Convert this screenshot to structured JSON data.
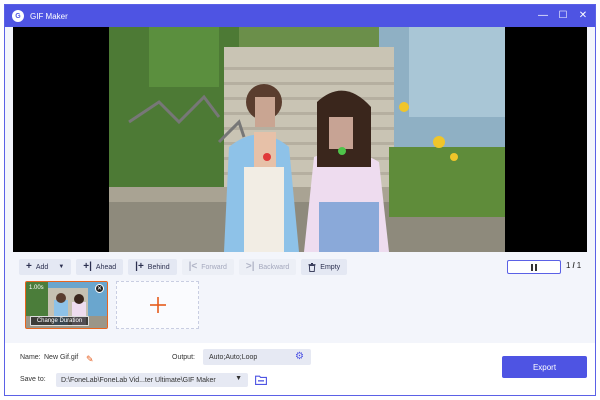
{
  "window": {
    "title": "GIF Maker",
    "minimize_glyph": "—",
    "maximize_glyph": "☐",
    "close_glyph": "✕"
  },
  "toolbar": {
    "add_label": "Add",
    "ahead_label": "Ahead",
    "behind_label": "Behind",
    "forward_label": "Forward",
    "backward_label": "Backward",
    "empty_label": "Empty"
  },
  "playback": {
    "current_page": "1",
    "total_pages": "1",
    "separator": "/"
  },
  "clips": [
    {
      "duration": "1.00s",
      "change_duration_label": "Change Duration"
    }
  ],
  "settings": {
    "name_label": "Name:",
    "name_value": "New Gif.gif",
    "output_label": "Output:",
    "output_value": "Auto;Auto;Loop",
    "save_label": "Save to:",
    "save_path": "D:\\FoneLab\\FoneLab Vid...ter Ultimate\\GIF Maker",
    "export_label": "Export"
  },
  "colors": {
    "accent": "#4e54e3",
    "clip_border": "#e8651e",
    "edit_icon": "#e55b1b"
  },
  "icons": {
    "add": "plus-icon",
    "ahead": "bring-forward-icon",
    "behind": "send-backward-icon",
    "empty": "trash-icon",
    "output_settings": "gear-icon",
    "folder": "folder-icon"
  }
}
